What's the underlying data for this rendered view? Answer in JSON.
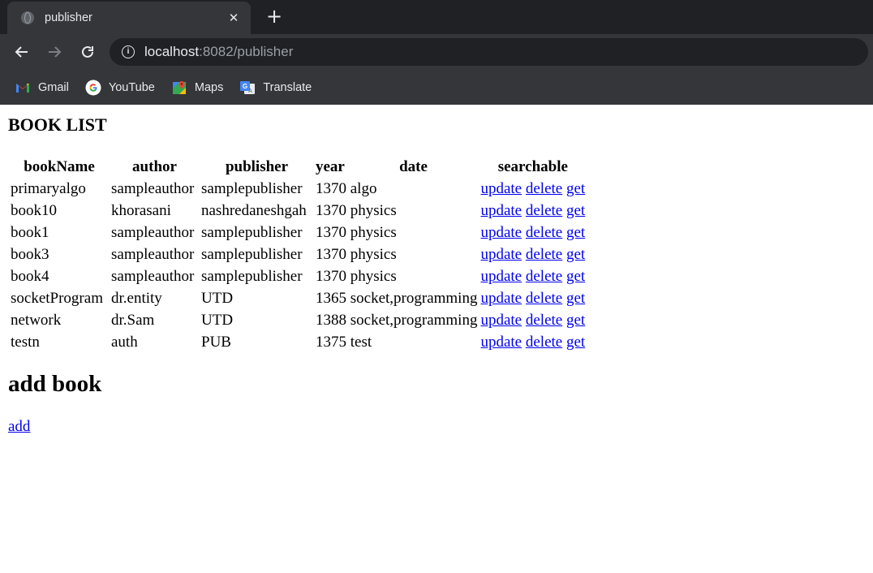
{
  "browser": {
    "tab_title": "publisher",
    "url_host": "localhost",
    "url_rest": ":8082/publisher",
    "bookmarks": [
      {
        "label": "Gmail",
        "icon": "gmail-icon"
      },
      {
        "label": "YouTube",
        "icon": "google-icon"
      },
      {
        "label": "Maps",
        "icon": "maps-icon"
      },
      {
        "label": "Translate",
        "icon": "translate-icon"
      }
    ]
  },
  "page": {
    "list_title": "BOOK LIST",
    "columns": [
      "bookName",
      "author",
      "publisher",
      "year",
      "date",
      "searchable"
    ],
    "rows": [
      {
        "bookName": "primaryalgo",
        "author": "sampleauthor",
        "publisher": "samplepublisher",
        "year_date": "1370 algo"
      },
      {
        "bookName": "book10",
        "author": "khorasani",
        "publisher": "nashredaneshgah",
        "year_date": "1370 physics"
      },
      {
        "bookName": "book1",
        "author": "sampleauthor",
        "publisher": "samplepublisher",
        "year_date": "1370 physics"
      },
      {
        "bookName": "book3",
        "author": "sampleauthor",
        "publisher": "samplepublisher",
        "year_date": "1370 physics"
      },
      {
        "bookName": "book4",
        "author": "sampleauthor",
        "publisher": "samplepublisher",
        "year_date": "1370 physics"
      },
      {
        "bookName": "socketProgram",
        "author": "dr.entity",
        "publisher": "UTD",
        "year_date": "1365 socket,programming"
      },
      {
        "bookName": "network",
        "author": "dr.Sam",
        "publisher": "UTD",
        "year_date": "1388 socket,programming"
      },
      {
        "bookName": "testn",
        "author": "auth",
        "publisher": "PUB",
        "year_date": "1375 test"
      }
    ],
    "actions": {
      "update": "update",
      "delete": "delete",
      "get": "get"
    },
    "add_title": "add book",
    "add_link": "add"
  },
  "colors": {
    "link": "#0000ee",
    "chrome_dark": "#202124",
    "chrome": "#35363a"
  }
}
